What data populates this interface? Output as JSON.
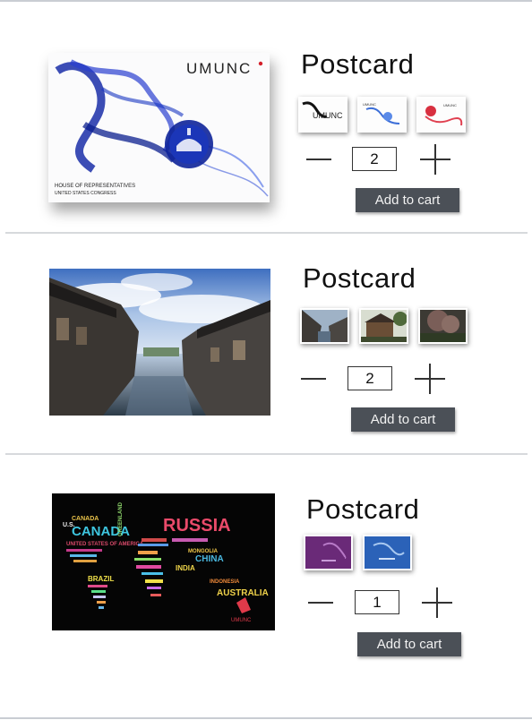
{
  "products": [
    {
      "title": "Postcard",
      "quantity": "2",
      "add_to_cart_label": "Add to cart",
      "image": {
        "brand": "UMUNC",
        "caption_line1": "HOUSE OF REPRESENTATIVES",
        "caption_line2": "UNITED STATES CONGRESS"
      },
      "thumbnails": [
        "postcard-umunc-black",
        "postcard-umunc-blue",
        "postcard-umunc-red"
      ]
    },
    {
      "title": "Postcard",
      "quantity": "2",
      "add_to_cart_label": "Add to cart",
      "image": {},
      "thumbnails": [
        "water-town-canal",
        "old-house-trees",
        "blossom-tree"
      ]
    },
    {
      "title": "Postcard",
      "quantity": "1",
      "add_to_cart_label": "Add to cart",
      "image": {
        "brand": "UMUNC",
        "words": [
          "RUSSIA",
          "CANADA",
          "U.S.",
          "CANADA",
          "GREENLAND",
          "UNITED STATES OF AMERICA",
          "CHINA",
          "INDIA",
          "BRAZIL",
          "AUSTRALIA",
          "INDONESIA",
          "MONGOLIA"
        ]
      },
      "thumbnails": [
        "purple-card",
        "blue-card"
      ]
    }
  ]
}
